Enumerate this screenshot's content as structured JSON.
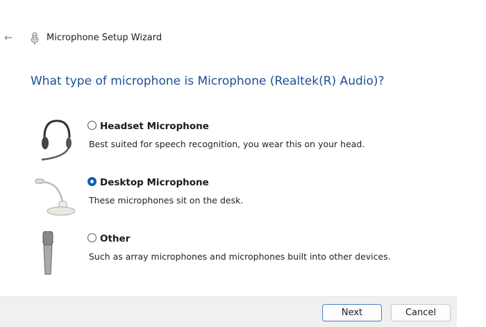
{
  "window": {
    "title": "Microphone Setup Wizard"
  },
  "question": "What type of microphone is Microphone (Realtek(R) Audio)?",
  "options": [
    {
      "label": "Headset Microphone",
      "description": "Best suited for speech recognition, you wear this on your head.",
      "selected": false
    },
    {
      "label": "Desktop Microphone",
      "description": "These microphones sit on the desk.",
      "selected": true
    },
    {
      "label": "Other",
      "description": "Such as array microphones and microphones built into other devices.",
      "selected": false
    }
  ],
  "buttons": {
    "next": "Next",
    "cancel": "Cancel"
  },
  "colors": {
    "accent": "#0a5fb4",
    "heading": "#1d4f91"
  }
}
